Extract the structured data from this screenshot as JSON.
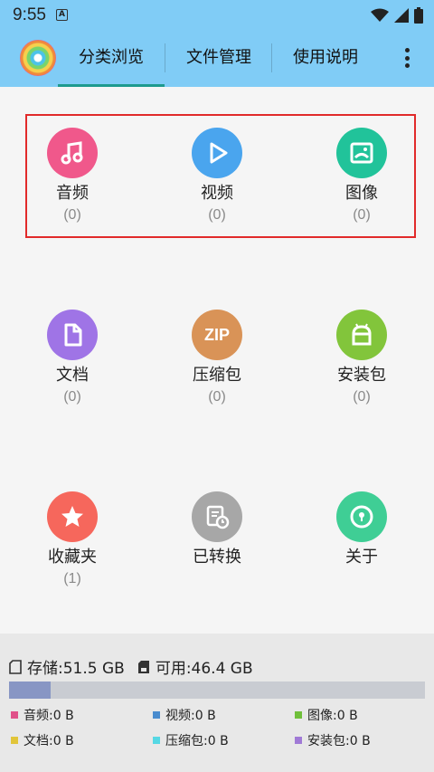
{
  "status": {
    "time": "9:55",
    "badge": "A"
  },
  "tabs": [
    {
      "label": "分类浏览"
    },
    {
      "label": "文件管理"
    },
    {
      "label": "使用说明"
    }
  ],
  "categories": [
    {
      "label": "音频",
      "count": "(0)",
      "color": "#f0588b",
      "icon": "music-icon"
    },
    {
      "label": "视频",
      "count": "(0)",
      "color": "#4aa5ee",
      "icon": "play-icon"
    },
    {
      "label": "图像",
      "count": "(0)",
      "color": "#21c39a",
      "icon": "image-icon"
    },
    {
      "label": "文档",
      "count": "(0)",
      "color": "#9f74e6",
      "icon": "document-icon"
    },
    {
      "label": "压缩包",
      "count": "(0)",
      "color": "#d99357",
      "icon": "zip-icon",
      "icon_text": "ZIP"
    },
    {
      "label": "安装包",
      "count": "(0)",
      "color": "#82c53b",
      "icon": "android-icon"
    },
    {
      "label": "收藏夹",
      "count": "(1)",
      "color": "#f6675c",
      "icon": "star-icon"
    },
    {
      "label": "已转换",
      "count": "",
      "color": "#a7a7a7",
      "icon": "converted-icon"
    },
    {
      "label": "关于",
      "count": "",
      "color": "#3fce95",
      "icon": "info-icon"
    }
  ],
  "storage": {
    "total_text": "存储:51.5 GB",
    "available_text": "可用:46.4 GB",
    "used_fraction": 0.1
  },
  "legend": [
    {
      "label": "音频:0 B",
      "color": "#e0528a"
    },
    {
      "label": "视频:0 B",
      "color": "#4a8cce"
    },
    {
      "label": "图像:0 B",
      "color": "#6fbf3a"
    },
    {
      "label": "文档:0 B",
      "color": "#e1c53a"
    },
    {
      "label": "压缩包:0 B",
      "color": "#56d8e4"
    },
    {
      "label": "安装包:0 B",
      "color": "#a07ad6"
    }
  ]
}
